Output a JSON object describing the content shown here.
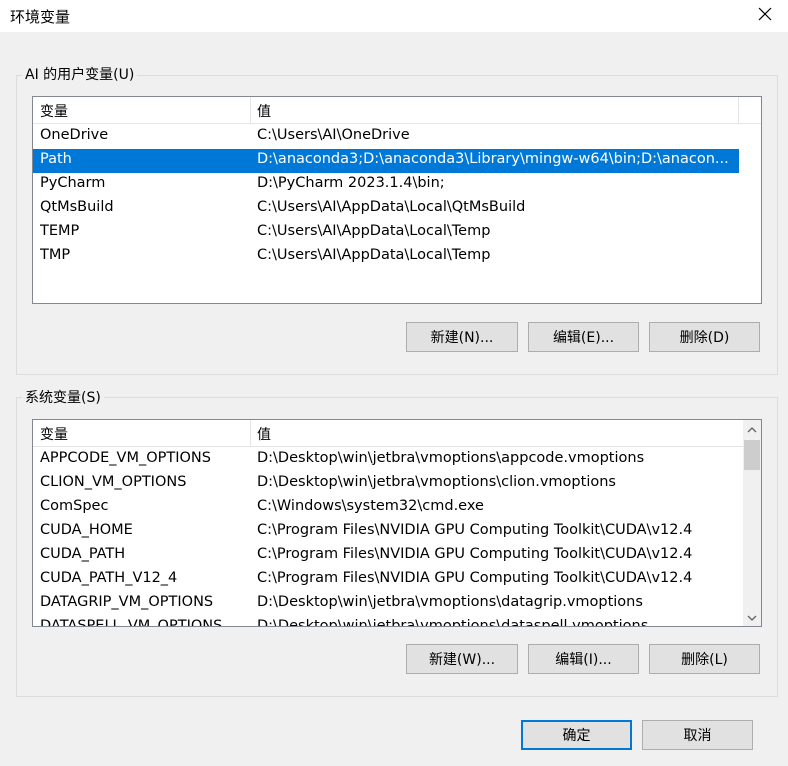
{
  "window": {
    "title": "环境变量",
    "close_icon": "close-icon"
  },
  "user_vars": {
    "group_label": "AI 的用户变量(U)",
    "col_name": "变量",
    "col_value": "值",
    "rows": [
      {
        "name": "OneDrive",
        "value": "C:\\Users\\AI\\OneDrive"
      },
      {
        "name": "Path",
        "value": "D:\\anaconda3;D:\\anaconda3\\Library\\mingw-w64\\bin;D:\\anacon..."
      },
      {
        "name": "PyCharm",
        "value": "D:\\PyCharm 2023.1.4\\bin;"
      },
      {
        "name": "QtMsBuild",
        "value": "C:\\Users\\AI\\AppData\\Local\\QtMsBuild"
      },
      {
        "name": "TEMP",
        "value": "C:\\Users\\AI\\AppData\\Local\\Temp"
      },
      {
        "name": "TMP",
        "value": "C:\\Users\\AI\\AppData\\Local\\Temp"
      }
    ],
    "selected": "Path",
    "buttons": {
      "new": "新建(N)...",
      "edit": "编辑(E)...",
      "delete": "删除(D)"
    }
  },
  "system_vars": {
    "group_label": "系统变量(S)",
    "col_name": "变量",
    "col_value": "值",
    "rows": [
      {
        "name": "APPCODE_VM_OPTIONS",
        "value": "D:\\Desktop\\win\\jetbra\\vmoptions\\appcode.vmoptions"
      },
      {
        "name": "CLION_VM_OPTIONS",
        "value": "D:\\Desktop\\win\\jetbra\\vmoptions\\clion.vmoptions"
      },
      {
        "name": "ComSpec",
        "value": "C:\\Windows\\system32\\cmd.exe"
      },
      {
        "name": "CUDA_HOME",
        "value": "C:\\Program Files\\NVIDIA GPU Computing Toolkit\\CUDA\\v12.4"
      },
      {
        "name": "CUDA_PATH",
        "value": "C:\\Program Files\\NVIDIA GPU Computing Toolkit\\CUDA\\v12.4"
      },
      {
        "name": "CUDA_PATH_V12_4",
        "value": "C:\\Program Files\\NVIDIA GPU Computing Toolkit\\CUDA\\v12.4"
      },
      {
        "name": "DATAGRIP_VM_OPTIONS",
        "value": "D:\\Desktop\\win\\jetbra\\vmoptions\\datagrip.vmoptions"
      },
      {
        "name": "DATASPELL_VM_OPTIONS",
        "value": "D:\\Desktop\\win\\jetbra\\vmoptions\\dataspell.vmoptions"
      }
    ],
    "buttons": {
      "new": "新建(W)...",
      "edit": "编辑(I)...",
      "delete": "删除(L)"
    }
  },
  "footer": {
    "ok": "确定",
    "cancel": "取消"
  },
  "colors": {
    "selection": "#0078d7",
    "default_button_border": "#0078d7"
  }
}
